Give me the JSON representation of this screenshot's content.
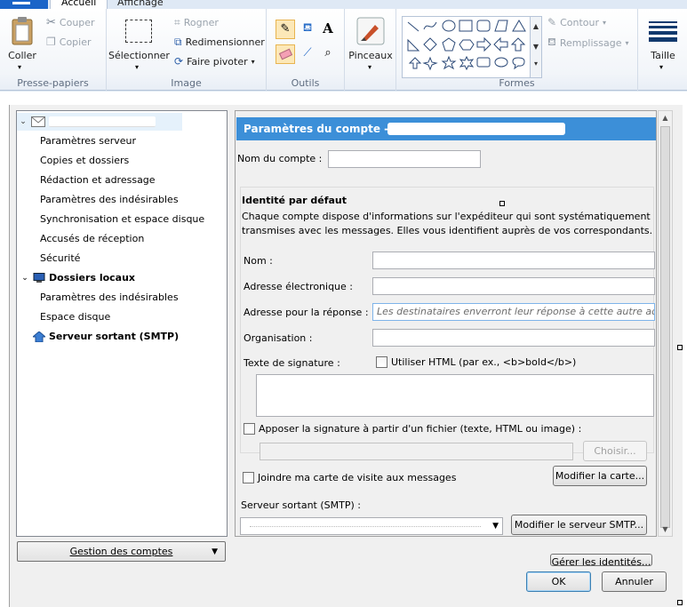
{
  "tabs": {
    "home": "Accueil",
    "view": "Affichage"
  },
  "ribbon": {
    "clipboard": {
      "paste": "Coller",
      "cut": "Couper",
      "copy": "Copier",
      "label": "Presse-papiers"
    },
    "image": {
      "select": "Sélectionner",
      "crop": "Rogner",
      "resize": "Redimensionner",
      "rotate": "Faire pivoter",
      "label": "Image"
    },
    "tools": {
      "label": "Outils"
    },
    "brushes": {
      "label": "Pinceaux"
    },
    "shapes": {
      "outline": "Contour",
      "fill": "Remplissage",
      "label": "Formes"
    },
    "size": {
      "label": "Taille"
    }
  },
  "tree": {
    "items": [
      {
        "label": "Paramètres serveur"
      },
      {
        "label": "Copies et dossiers"
      },
      {
        "label": "Rédaction et adressage"
      },
      {
        "label": "Paramètres des indésirables"
      },
      {
        "label": "Synchronisation et espace disque"
      },
      {
        "label": "Accusés de réception"
      },
      {
        "label": "Sécurité"
      },
      {
        "label": "Dossiers locaux"
      },
      {
        "label": "Paramètres des indésirables"
      },
      {
        "label": "Espace disque"
      },
      {
        "label": "Serveur sortant (SMTP)"
      }
    ],
    "manage_button": "Gestion des comptes"
  },
  "panel": {
    "title": "Paramètres du compte -",
    "account_name_label": "Nom du compte :",
    "identity_heading": "Identité par défaut",
    "identity_desc_1": "Chaque compte dispose d'informations sur l'expéditeur qui sont systématiquement",
    "identity_desc_2": "transmises avec les messages. Elles vous identifient auprès de vos correspondants.",
    "name_label": "Nom :",
    "email_label": "Adresse électronique :",
    "reply_label": "Adresse pour la réponse :",
    "reply_placeholder": "Les destinataires enverront leur réponse à cette autre adresse",
    "org_label": "Organisation :",
    "signature_label": "Texte de signature :",
    "use_html": "Utiliser HTML (par ex., <b>bold</b>)",
    "attach_sig_file": "Apposer la signature à partir d'un fichier (texte, HTML ou image) :",
    "choose_button": "Choisir...",
    "attach_vcard": "Joindre ma carte de visite aux messages",
    "edit_card_button": "Modifier la carte...",
    "smtp_label": "Serveur sortant (SMTP) :",
    "edit_smtp_button": "Modifier le serveur SMTP...",
    "manage_identities_button": "Gérer les identités..."
  },
  "footer": {
    "ok": "OK",
    "cancel": "Annuler"
  },
  "colors": {
    "header_blue": "#3c8fd8",
    "app_button": "#1a64c8"
  }
}
